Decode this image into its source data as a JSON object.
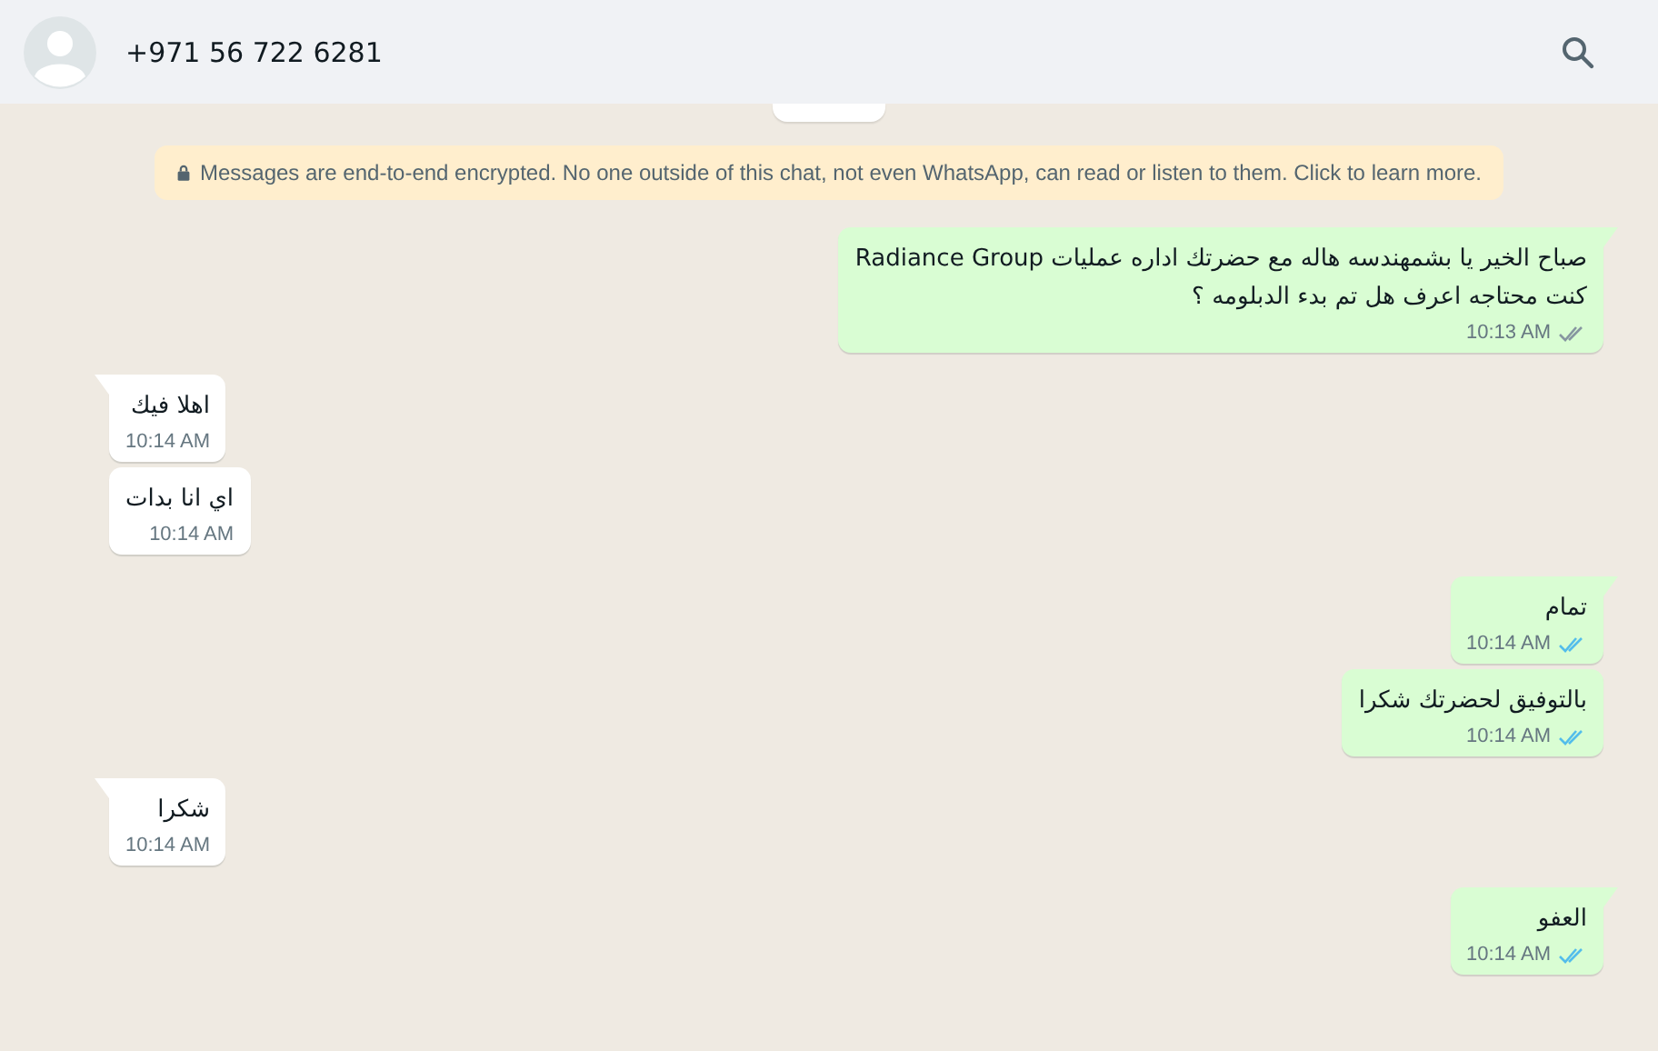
{
  "header": {
    "contact": "+971 56 722 6281"
  },
  "encryption_notice": "Messages are end-to-end encrypted. No one outside of this chat, not even WhatsApp, can read or listen to them. Click to learn more.",
  "messages": [
    {
      "kind": "out",
      "tail": true,
      "text": "صباح الخير يا بشمهندسه هاله مع حضرتك اداره عمليات Radiance Group\nكنت محتاجه اعرف هل تم بدء الدبلومه ؟",
      "time": "10:13 AM",
      "read": false
    },
    {
      "kind": "in",
      "tail": true,
      "text": "اهلا فيك",
      "time": "10:14 AM"
    },
    {
      "kind": "in",
      "tail": false,
      "text": "اي انا بدات",
      "time": "10:14 AM"
    },
    {
      "kind": "out",
      "tail": true,
      "text": "تمام",
      "time": "10:14 AM",
      "read": true
    },
    {
      "kind": "out",
      "tail": false,
      "text": "بالتوفيق لحضرتك شكرا",
      "time": "10:14 AM",
      "read": true
    },
    {
      "kind": "in",
      "tail": true,
      "text": "شكرا",
      "time": "10:14 AM"
    },
    {
      "kind": "out",
      "tail": true,
      "text": "العفو",
      "time": "10:14 AM",
      "read": true
    }
  ]
}
